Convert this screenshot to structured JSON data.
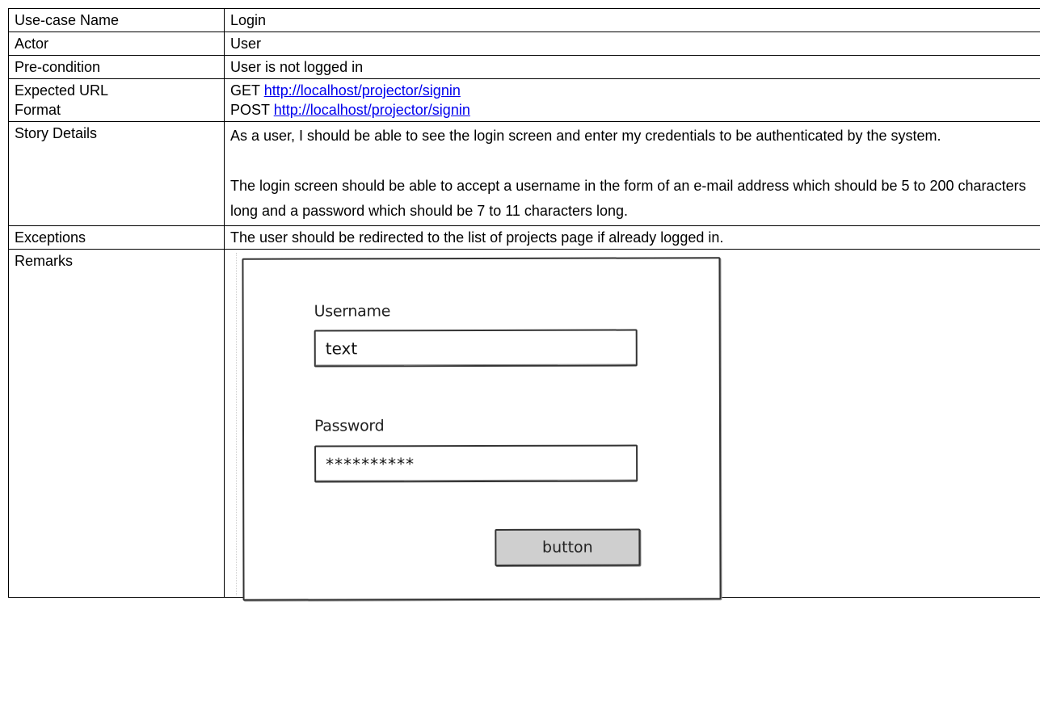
{
  "table": {
    "rows": [
      {
        "label": "Use-case Name",
        "value": "Login"
      },
      {
        "label": "Actor",
        "value": "User"
      },
      {
        "label": "Pre-condition",
        "value": "User is not logged in"
      }
    ],
    "url_row": {
      "label_line1": "Expected URL",
      "label_line2": "Format",
      "get_prefix": "GET",
      "get_url": "http://localhost/projector/signin",
      "post_prefix": "POST",
      "post_url": "http://localhost/projector/signin"
    },
    "story_row": {
      "label": "Story Details",
      "para1": "As a user, I should be able to see the login screen and enter my credentials to be authenticated by the system.",
      "para2": "The login screen should be able to accept a username in the form of an e-mail address which should be 5 to 200 characters long and a password which should be 7 to 11 characters long."
    },
    "exceptions_row": {
      "label": "Exceptions",
      "value": "The user should be redirected to the list of projects page if already logged in."
    },
    "remarks_row": {
      "label": "Remarks"
    }
  },
  "mockup": {
    "username_label": "Username",
    "username_value": "text",
    "password_label": "Password",
    "password_value": "**********",
    "button_label": "button"
  }
}
